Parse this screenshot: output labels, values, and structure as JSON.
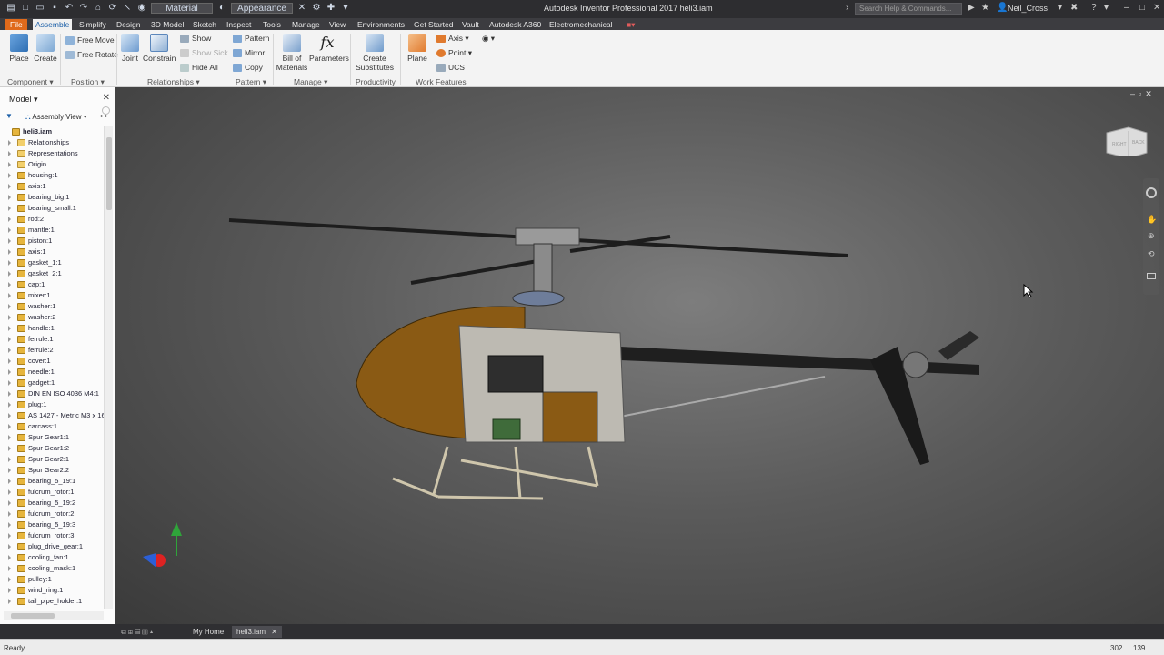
{
  "window": {
    "title": "Autodesk Inventor Professional 2017    heli3.iam",
    "search_placeholder": "Search Help & Commands...",
    "user": "Neil_Cross",
    "combo1": "Material",
    "combo2": "Appearance"
  },
  "tabs": [
    "File",
    "Assemble",
    "Simplify",
    "Design",
    "3D Model",
    "Sketch",
    "Inspect",
    "Tools",
    "Manage",
    "View",
    "Environments",
    "Get Started",
    "Vault",
    "Autodesk A360",
    "Electromechanical"
  ],
  "ribbon": {
    "place": "Place",
    "create": "Create",
    "free_move": "Free Move",
    "free_rotate": "Free Rotate",
    "joint": "Joint",
    "constrain": "Constrain",
    "show": "Show",
    "show_sick": "Show Sick",
    "hide_all": "Hide All",
    "pattern": "Pattern",
    "mirror": "Mirror",
    "copy": "Copy",
    "bill_line1": "Bill of",
    "bill_line2": "Materials",
    "parameters": "Parameters",
    "create_sub_line1": "Create",
    "create_sub_line2": "Substitutes",
    "plane": "Plane",
    "axis": "Axis",
    "point": "Point",
    "ucs": "UCS",
    "panels": {
      "component": "Component",
      "position": "Position",
      "relationships": "Relationships",
      "pattern": "Pattern",
      "manage": "Manage",
      "productivity": "Productivity",
      "work_features": "Work Features"
    }
  },
  "browser": {
    "title": "Model",
    "view": "Assembly View",
    "root": "heli3.iam",
    "items": [
      "Relationships",
      "Representations",
      "Origin",
      "housing:1",
      "axis:1",
      "bearing_big:1",
      "bearing_small:1",
      "rod:2",
      "mantle:1",
      "piston:1",
      "axis:1",
      "gasket_1:1",
      "gasket_2:1",
      "cap:1",
      "mixer:1",
      "washer:1",
      "washer:2",
      "handle:1",
      "ferrule:1",
      "ferrule:2",
      "cover:1",
      "needle:1",
      "gadget:1",
      "DIN EN ISO 4036 M4:1",
      "plug:1",
      "AS 1427 - Metric M3 x 16",
      "carcass:1",
      "Spur Gear1:1",
      "Spur Gear1:2",
      "Spur Gear2:1",
      "Spur Gear2:2",
      "bearing_5_19:1",
      "fulcrum_rotor:1",
      "bearing_5_19:2",
      "fulcrum_rotor:2",
      "bearing_5_19:3",
      "fulcrum_rotor:3",
      "plug_drive_gear:1",
      "cooling_fan:1",
      "cooling_mask:1",
      "pulley:1",
      "wind_ring:1",
      "tail_pipe_holder:1"
    ]
  },
  "viewcube": {
    "right": "RIGHT",
    "back": "BACK"
  },
  "doc_tabs": {
    "home": "My Home",
    "doc": "heli3.iam"
  },
  "status": {
    "text": "Ready",
    "count_a": "302",
    "count_b": "139"
  },
  "colors": {
    "file_tab": "#e06a1b",
    "active_tab_text": "#1b5fa8",
    "viewport_bg": "#5b5b5b",
    "canopy": "#8a5a14"
  }
}
